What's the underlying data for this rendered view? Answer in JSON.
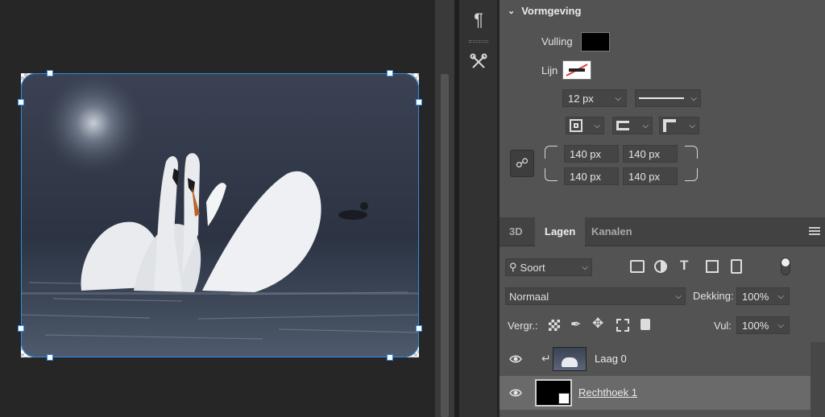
{
  "properties": {
    "section_title": "Vormgeving",
    "fill_label": "Vulling",
    "stroke_label": "Lijn",
    "stroke_width": "12 px",
    "corners": {
      "top_left": "140 px",
      "top_right": "140 px",
      "bottom_left": "140 px",
      "bottom_right": "140 px"
    },
    "fill_color": "#000000"
  },
  "layers_panel": {
    "tabs": [
      "3D",
      "Lagen",
      "Kanalen"
    ],
    "filter_label": "Soort",
    "blend_mode": "Normaal",
    "opacity_label": "Dekking:",
    "opacity_value": "100%",
    "lock_label": "Vergr.:",
    "fill_label": "Vul:",
    "fill_value": "100%",
    "layers": [
      {
        "name": "Laag 0",
        "selected": false
      },
      {
        "name": "Rechthoek 1",
        "selected": true
      }
    ]
  },
  "tools": {
    "paragraph_icon": "pilcrow-icon",
    "tools_icon": "wrench-screwdriver-icon"
  },
  "colors": {
    "selection_blue": "#2f8de4",
    "panel_bg": "#535353"
  }
}
